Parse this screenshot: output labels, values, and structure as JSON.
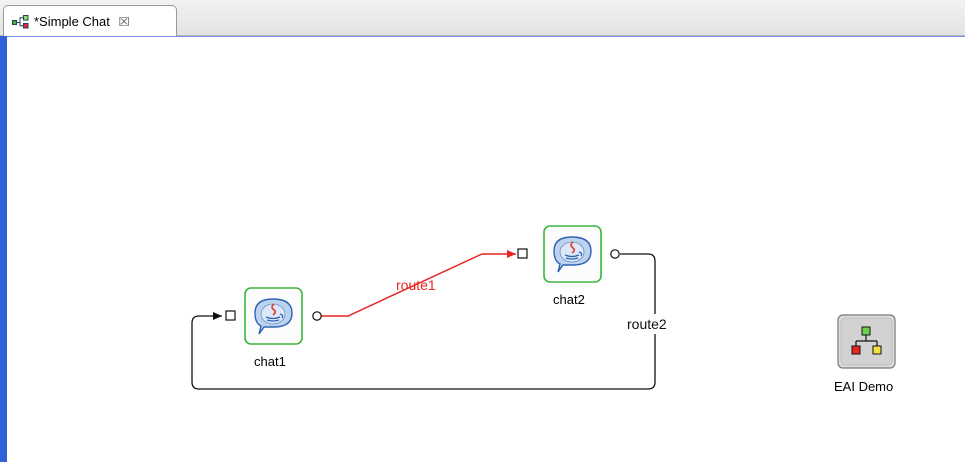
{
  "tab": {
    "title": "*Simple Chat",
    "icon": "diagram-icon",
    "close_icon": "close-icon"
  },
  "nodes": {
    "chat1": {
      "label": "chat1",
      "icon": "java-chat-icon"
    },
    "chat2": {
      "label": "chat2",
      "icon": "java-chat-icon"
    },
    "eai": {
      "label": "EAI Demo",
      "icon": "network-tree-icon"
    }
  },
  "routes": {
    "route1": {
      "label": "route1",
      "color": "#e8251e"
    },
    "route2": {
      "label": "route2",
      "color": "#222222"
    }
  },
  "colors": {
    "node_border": "#3ab83a",
    "canvas_edge": "#2f62d6"
  }
}
